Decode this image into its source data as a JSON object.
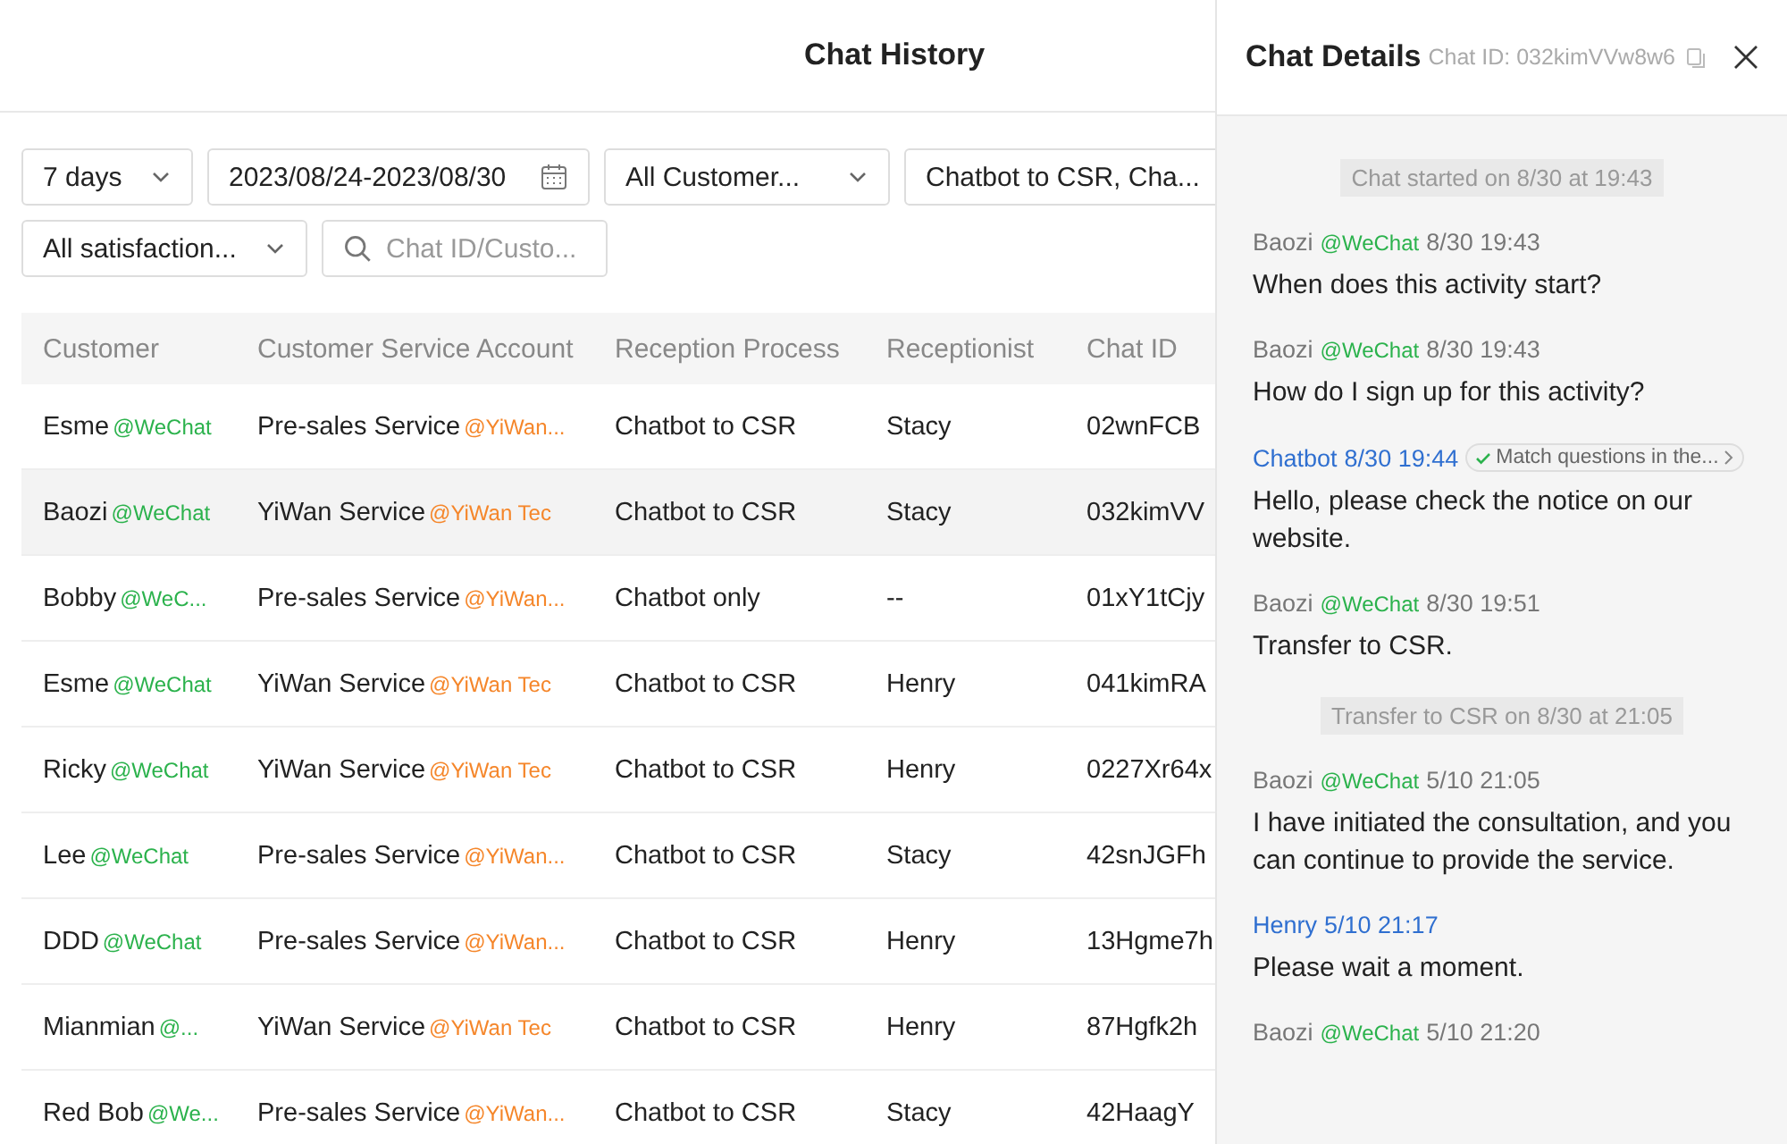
{
  "page": {
    "title": "Chat History"
  },
  "filters": [
    {
      "kind": "select",
      "value": "7 days"
    },
    {
      "kind": "date",
      "value": "2023/08/24-2023/08/30"
    },
    {
      "kind": "select",
      "value": "All Customer..."
    },
    {
      "kind": "select",
      "value": "Chatbot to CSR, Cha..."
    },
    {
      "kind": "select",
      "value": "All satisfaction..."
    },
    {
      "kind": "search",
      "placeholder": "Chat ID/Custo..."
    }
  ],
  "table": {
    "columns": [
      "Customer",
      "Customer Service Account",
      "Reception Process",
      "Receptionist",
      "Chat ID"
    ],
    "rows": [
      {
        "selected": false,
        "customer": "Esme",
        "channel": "@WeChat",
        "account": "Pre-sales Service",
        "org": "@YiWan...",
        "process": "Chatbot to CSR",
        "receptionist": "Stacy",
        "chat_id": "02wnFCB"
      },
      {
        "selected": true,
        "customer": "Baozi",
        "channel": "@WeChat",
        "account": "YiWan Service",
        "org": "@YiWan Tec",
        "process": "Chatbot to CSR",
        "receptionist": "Stacy",
        "chat_id": "032kimVV"
      },
      {
        "selected": false,
        "customer": "Bobby",
        "channel": "@WeC...",
        "account": "Pre-sales Service",
        "org": "@YiWan...",
        "process": "Chatbot only",
        "receptionist": "--",
        "chat_id": "01xY1tCjy"
      },
      {
        "selected": false,
        "customer": "Esme",
        "channel": "@WeChat",
        "account": "YiWan Service",
        "org": "@YiWan Tec",
        "process": "Chatbot to CSR",
        "receptionist": "Henry",
        "chat_id": "041kimRA"
      },
      {
        "selected": false,
        "customer": "Ricky",
        "channel": "@WeChat",
        "account": "YiWan Service",
        "org": "@YiWan Tec",
        "process": "Chatbot to CSR",
        "receptionist": "Henry",
        "chat_id": "0227Xr64x"
      },
      {
        "selected": false,
        "customer": "Lee",
        "channel": "@WeChat",
        "account": "Pre-sales Service",
        "org": "@YiWan...",
        "process": "Chatbot to CSR",
        "receptionist": "Stacy",
        "chat_id": "42snJGFh"
      },
      {
        "selected": false,
        "customer": "DDD",
        "channel": "@WeChat",
        "account": "Pre-sales Service",
        "org": "@YiWan...",
        "process": "Chatbot to CSR",
        "receptionist": "Henry",
        "chat_id": "13Hgme7h"
      },
      {
        "selected": false,
        "customer": "Mianmian",
        "channel": "@...",
        "account": "YiWan Service",
        "org": "@YiWan Tec",
        "process": "Chatbot to CSR",
        "receptionist": "Henry",
        "chat_id": "87Hgfk2h"
      },
      {
        "selected": false,
        "customer": "Red Bob",
        "channel": "@We...",
        "account": "Pre-sales Service",
        "org": "@YiWan...",
        "process": "Chatbot to CSR",
        "receptionist": "Stacy",
        "chat_id": "42HaagY"
      }
    ]
  },
  "drawer": {
    "title": "Chat Details",
    "chat_id": "Chat ID: 032kimVVw8w6",
    "messages": [
      {
        "kind": "system",
        "text": "Chat started on 8/30 at 19:43"
      },
      {
        "kind": "customer",
        "sender": "Baozi",
        "channel": "@WeChat",
        "time": "8/30 19:43",
        "text": "When does this activity start?"
      },
      {
        "kind": "customer",
        "sender": "Baozi",
        "channel": "@WeChat",
        "time": "8/30 19:43",
        "text": "How do I sign up for this activity?"
      },
      {
        "kind": "agent",
        "sender": "Chatbot",
        "time": "8/30 19:44",
        "tag": "Match questions in the...",
        "text": "Hello, please check the notice on our website."
      },
      {
        "kind": "customer",
        "sender": "Baozi",
        "channel": "@WeChat",
        "time": "8/30 19:51",
        "text": "Transfer to CSR."
      },
      {
        "kind": "system",
        "text": "Transfer to CSR on 8/30 at 21:05"
      },
      {
        "kind": "customer",
        "sender": "Baozi",
        "channel": "@WeChat",
        "time": "5/10 21:05",
        "text": "I have initiated the consultation, and you can continue to provide the service."
      },
      {
        "kind": "agent",
        "sender": "Henry",
        "time": "5/10 21:17",
        "text": "Please wait a moment."
      },
      {
        "kind": "customer",
        "sender": "Baozi",
        "channel": "@WeChat",
        "time": "5/10 21:20"
      }
    ]
  }
}
